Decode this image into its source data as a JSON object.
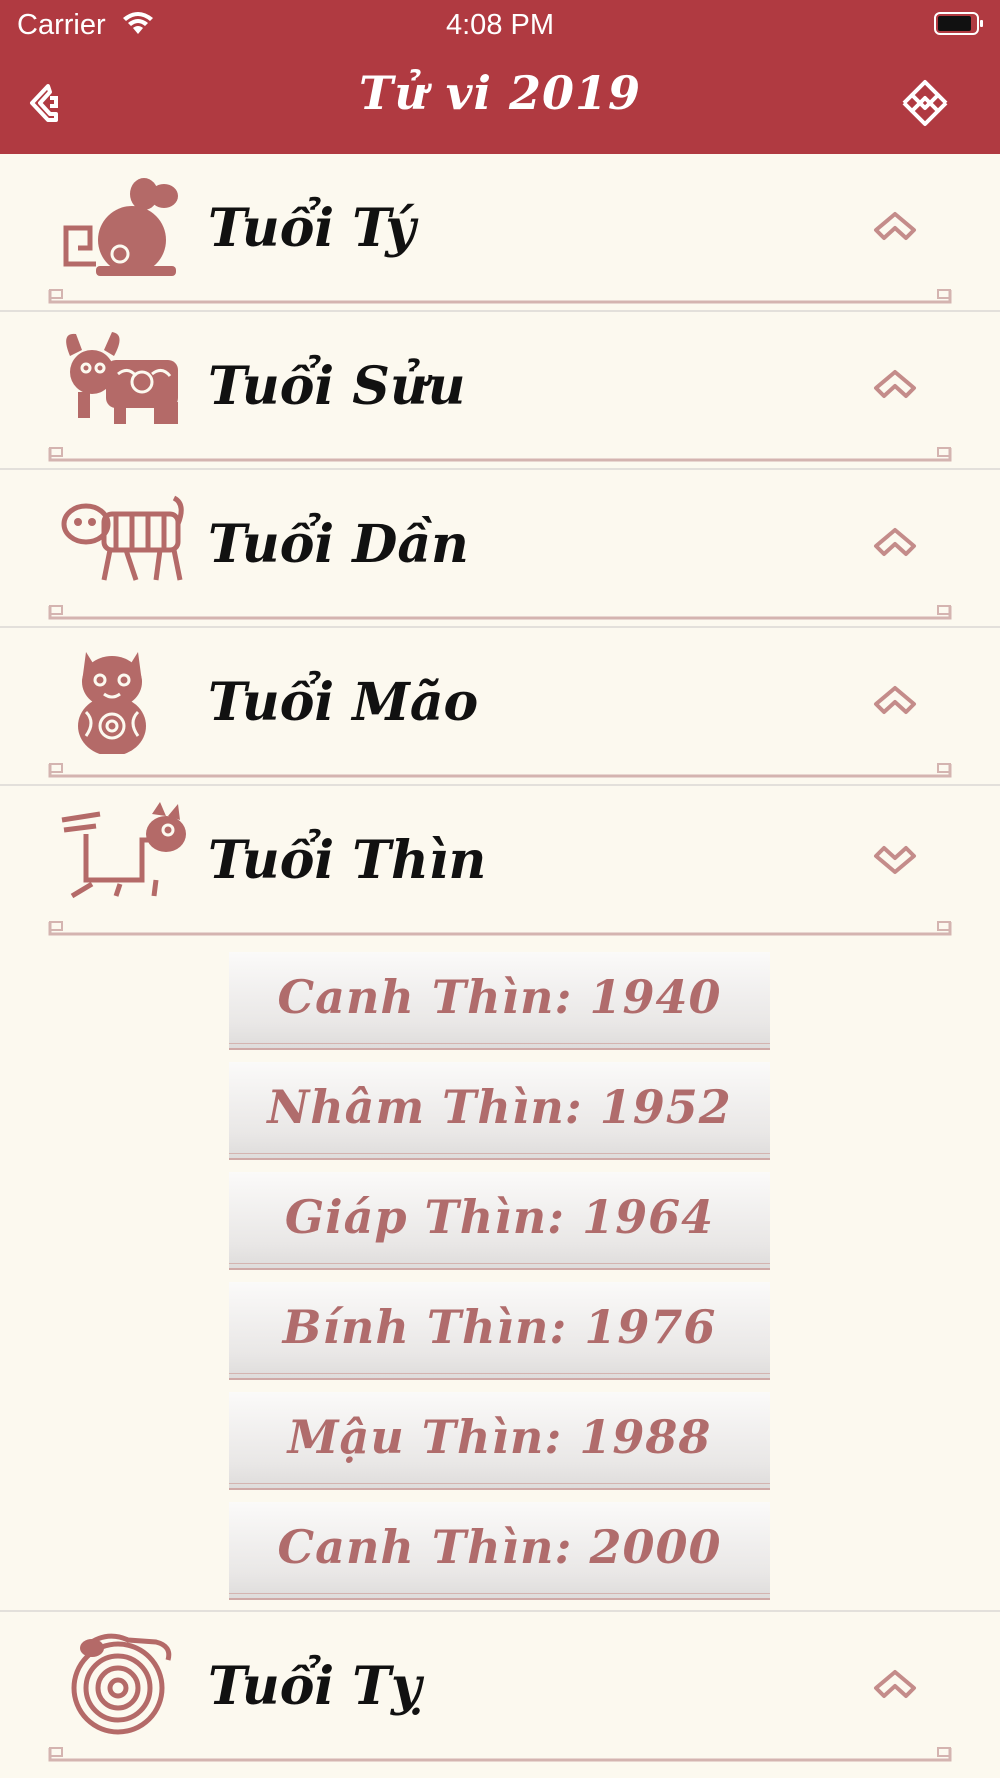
{
  "status_bar": {
    "carrier": "Carrier",
    "time": "4:08 PM"
  },
  "nav": {
    "title": "Tử vi 2019",
    "back_icon": "back-chevron-icon",
    "menu_icon": "knot-menu-icon"
  },
  "colors": {
    "accent": "#b03a41",
    "background": "#fcf9ef",
    "ornament": "#c48c8a",
    "sub_text": "#b06c6c"
  },
  "zodiac": [
    {
      "label": "Tuổi Tý",
      "icon": "rat-icon",
      "expanded": false
    },
    {
      "label": "Tuổi Sửu",
      "icon": "ox-icon",
      "expanded": false
    },
    {
      "label": "Tuổi Dần",
      "icon": "tiger-icon",
      "expanded": false
    },
    {
      "label": "Tuổi Mão",
      "icon": "cat-icon",
      "expanded": false
    },
    {
      "label": "Tuổi Thìn",
      "icon": "dragon-icon",
      "expanded": true
    },
    {
      "label": "Tuổi Tỵ",
      "icon": "snake-icon",
      "expanded": false
    }
  ],
  "thin_years": [
    "Canh Thìn: 1940",
    "Nhâm Thìn: 1952",
    "Giáp Thìn: 1964",
    "Bính Thìn: 1976",
    "Mậu Thìn: 1988",
    "Canh Thìn: 2000"
  ]
}
